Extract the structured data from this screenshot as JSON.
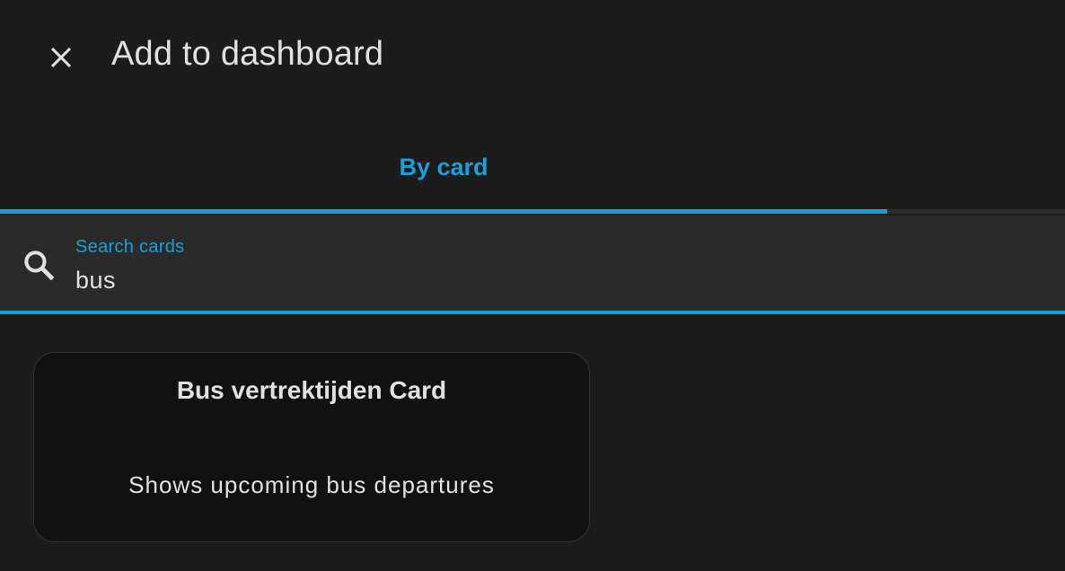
{
  "dialog": {
    "title": "Add to dashboard",
    "close_icon": "close-icon"
  },
  "tabs": [
    {
      "label": "By card",
      "active": true
    }
  ],
  "search": {
    "label": "Search cards",
    "value": "bus",
    "icon": "search-icon"
  },
  "results": [
    {
      "title": "Bus vertrektijden Card",
      "description": "Shows upcoming bus departures"
    }
  ],
  "colors": {
    "accent": "#0fa2d4",
    "background": "#1c1c1c",
    "search_background": "#2a2a2a",
    "card_background": "#111111",
    "text": "#e1e1e1"
  }
}
